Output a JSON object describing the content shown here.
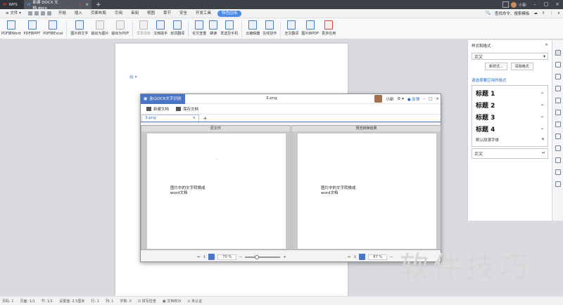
{
  "titlebar": {
    "app_tab": "WPS",
    "doc_tab": "新建 DOCX 文档.docx",
    "user_name": "小新"
  },
  "menubar": {
    "file": "文件",
    "items": [
      "开始",
      "插入",
      "页面布局",
      "引用",
      "审阅",
      "视图",
      "章节",
      "安全",
      "开发工具"
    ],
    "active": "特色应用",
    "search": "查找命令、搜索模板"
  },
  "ribbon": {
    "buttons": [
      {
        "label": "PDF转Word",
        "icon": "pdf-to-word-icon"
      },
      {
        "label": "PDF转PPT",
        "icon": "pdf-to-ppt-icon"
      },
      {
        "label": "PDF转Excel",
        "icon": "pdf-to-excel-icon"
      },
      {
        "label": "图片转文字",
        "icon": "image-to-text-icon"
      },
      {
        "label": "输出为图片",
        "icon": "export-image-icon"
      },
      {
        "label": "输出为PDF",
        "icon": "export-pdf-icon"
      },
      {
        "label": "屏幕录制",
        "icon": "screen-record-icon"
      },
      {
        "label": "文档助手",
        "icon": "doc-assistant-icon"
      },
      {
        "label": "划词翻译",
        "icon": "translate-icon"
      },
      {
        "label": "论文查重",
        "icon": "paper-check-icon"
      },
      {
        "label": "朗读",
        "icon": "read-aloud-icon"
      },
      {
        "label": "发送至手机",
        "icon": "send-phone-icon"
      },
      {
        "label": "云编辑器",
        "icon": "cloud-editor-icon"
      },
      {
        "label": "在线协作",
        "icon": "collab-icon"
      },
      {
        "label": "全文翻译",
        "icon": "full-translate-icon"
      },
      {
        "label": "图片转PDF",
        "icon": "image-to-pdf-icon"
      },
      {
        "label": "更多应用",
        "icon": "more-apps-icon"
      }
    ]
  },
  "rightpanel": {
    "title": "样式和格式 ·",
    "current_style": "正文",
    "new_style": "新样式...",
    "clear_format": "清除格式",
    "apply_heading": "请选择要应用的格式",
    "headings": [
      "标题 1",
      "标题 2",
      "标题 3",
      "标题 4"
    ],
    "default_font": "默认段落字体",
    "body_style": "正文"
  },
  "ocr": {
    "badge": "金山OCR文字识别",
    "file_title": "3.png",
    "user": "小新",
    "feedback": "反馈",
    "new_doc": "新建文档",
    "save_doc": "保存文档",
    "tab_name": "3.png",
    "left_label": "原文件",
    "right_label": "预览转换结果",
    "left_text_1": "图片中的文字转换成",
    "left_text_2": "word文档",
    "right_text_1": "图片中的文字转换成",
    "right_text_2": "word文档",
    "left_zoom": "70 %",
    "right_zoom": "87 %"
  },
  "statusbar": {
    "items": [
      "页码: 1",
      "页面: 1/1",
      "节: 1/1",
      "设置值: 2.5厘米",
      "行: 1",
      "列: 1",
      "字数: 0",
      "拼写检查",
      "文档校对",
      "未认证"
    ]
  },
  "watermark": "软件技巧"
}
